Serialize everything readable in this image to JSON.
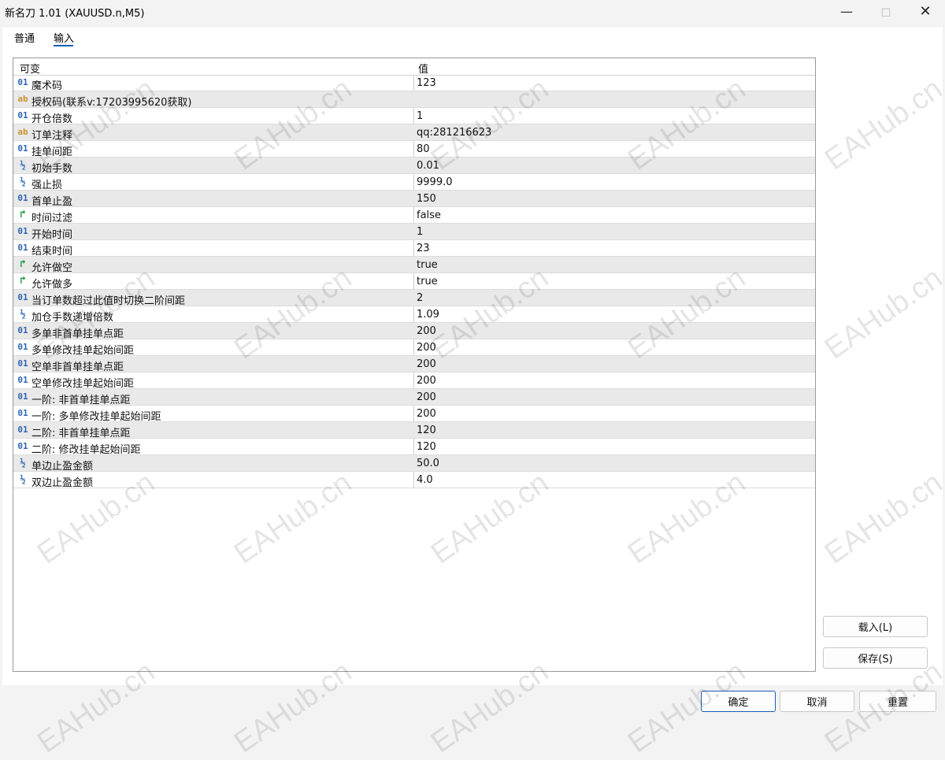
{
  "window": {
    "title": "新名刀 1.01 (XAUUSD.n,M5)"
  },
  "tabs": [
    {
      "label": "普通"
    },
    {
      "label": "输入"
    }
  ],
  "table": {
    "headers": {
      "name": "可变",
      "value": "值"
    },
    "rows": [
      {
        "type": "int",
        "name": "魔术码",
        "value": "123"
      },
      {
        "type": "str",
        "name": "授权码(联系v:17203995620获取)",
        "value": ""
      },
      {
        "type": "int",
        "name": "开仓倍数",
        "value": "1"
      },
      {
        "type": "str",
        "name": "订单注释",
        "value": "qq:281216623"
      },
      {
        "type": "int",
        "name": "挂单间距",
        "value": "80"
      },
      {
        "type": "dbl",
        "name": "初始手数",
        "value": "0.01"
      },
      {
        "type": "dbl",
        "name": "强止损",
        "value": "9999.0"
      },
      {
        "type": "int",
        "name": "首单止盈",
        "value": "150"
      },
      {
        "type": "bool",
        "name": "时间过滤",
        "value": "false"
      },
      {
        "type": "int",
        "name": "开始时间",
        "value": "1"
      },
      {
        "type": "int",
        "name": "结束时间",
        "value": "23"
      },
      {
        "type": "bool",
        "name": "允许做空",
        "value": "true"
      },
      {
        "type": "bool",
        "name": "允许做多",
        "value": "true"
      },
      {
        "type": "int",
        "name": "当订单数超过此值时切换二阶间距",
        "value": "2"
      },
      {
        "type": "dbl",
        "name": "加仓手数递增倍数",
        "value": "1.09"
      },
      {
        "type": "int",
        "name": "多单非首单挂单点距",
        "value": "200"
      },
      {
        "type": "int",
        "name": "多单修改挂单起始间距",
        "value": "200"
      },
      {
        "type": "int",
        "name": "空单非首单挂单点距",
        "value": "200"
      },
      {
        "type": "int",
        "name": "空单修改挂单起始间距",
        "value": "200"
      },
      {
        "type": "int",
        "name": "一阶: 非首单挂单点距",
        "value": "200"
      },
      {
        "type": "int",
        "name": "一阶: 多单修改挂单起始间距",
        "value": "200"
      },
      {
        "type": "int",
        "name": "二阶: 非首单挂单点距",
        "value": "120"
      },
      {
        "type": "int",
        "name": "二阶: 修改挂单起始间距",
        "value": "120"
      },
      {
        "type": "dbl",
        "name": "单边止盈金额",
        "value": "50.0"
      },
      {
        "type": "dbl",
        "name": "双边止盈金额",
        "value": "4.0"
      }
    ]
  },
  "type_glyphs": {
    "int": "01",
    "str": "ab",
    "dbl": "½",
    "bool": "↱"
  },
  "buttons": {
    "load": "载入(L)",
    "save": "保存(S)",
    "ok": "确定",
    "cancel": "取消",
    "reset": "重置"
  },
  "watermark_text": "EAHub.cn",
  "icons": {
    "minimize": "minimize-icon",
    "maximize": "maximize-icon",
    "close": "close-icon"
  }
}
